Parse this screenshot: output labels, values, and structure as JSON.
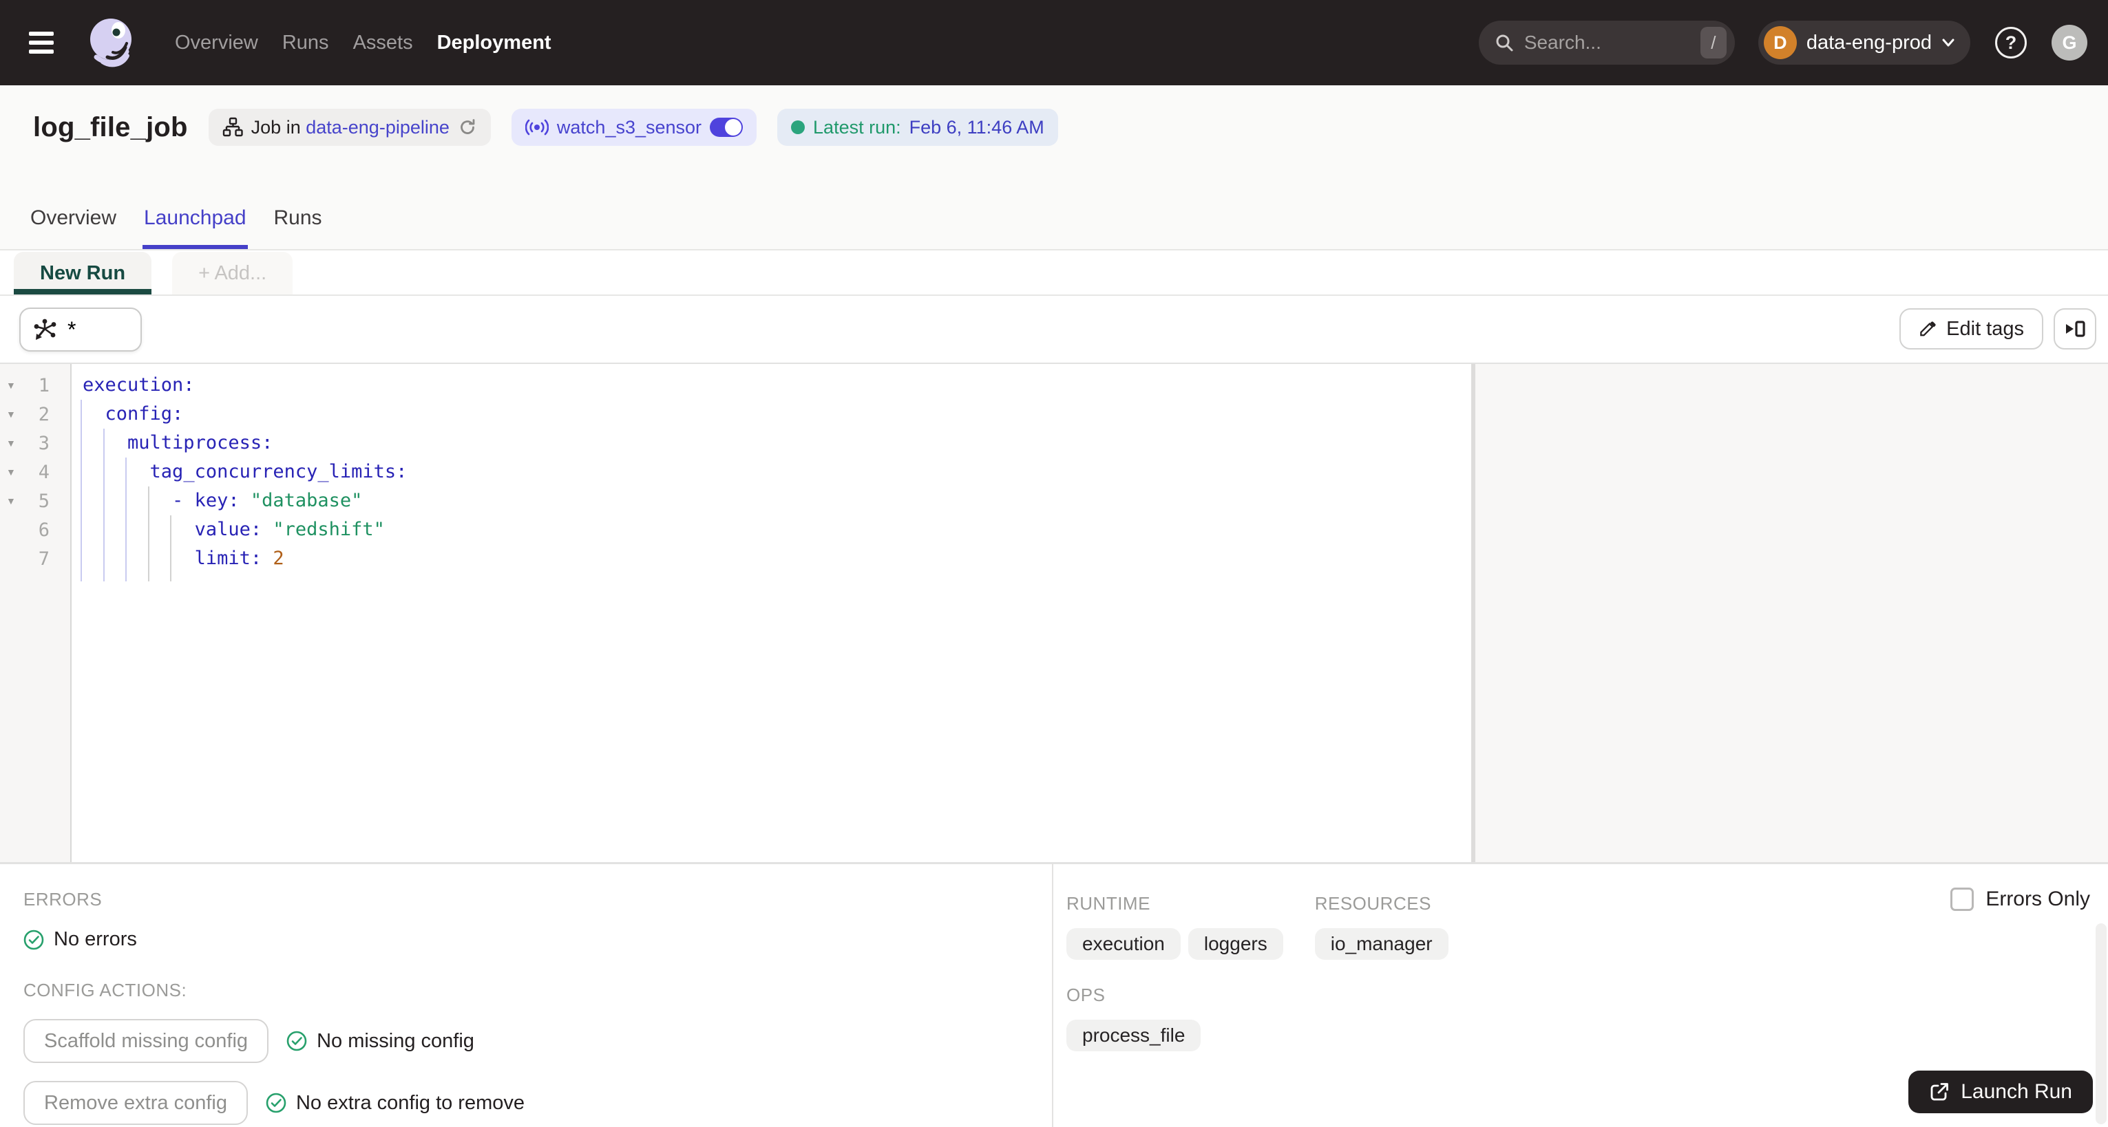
{
  "nav": {
    "items": [
      {
        "label": "Overview",
        "active": false
      },
      {
        "label": "Runs",
        "active": false
      },
      {
        "label": "Assets",
        "active": false
      },
      {
        "label": "Deployment",
        "active": true
      }
    ],
    "search_placeholder": "Search...",
    "search_shortcut": "/",
    "deployment_name": "data-eng-prod",
    "deployment_initial": "D",
    "help_glyph": "?",
    "avatar_initial": "G"
  },
  "header": {
    "title": "log_file_job",
    "job_pill": {
      "prefix": "Job in",
      "link": "data-eng-pipeline"
    },
    "sensor_pill": {
      "name": "watch_s3_sensor",
      "enabled": true
    },
    "latest_run": {
      "label": "Latest run:",
      "value": "Feb 6, 11:46 AM"
    },
    "tabs": [
      {
        "label": "Overview",
        "active": false
      },
      {
        "label": "Launchpad",
        "active": true
      },
      {
        "label": "Runs",
        "active": false
      }
    ]
  },
  "launchpad": {
    "config_tabs": [
      {
        "label": "New Run",
        "active": true
      },
      {
        "label": "+ Add...",
        "active": false
      }
    ],
    "op_selector_value": "*",
    "edit_tags_label": "Edit tags"
  },
  "editor": {
    "lines": [
      {
        "n": 1,
        "fold": true,
        "tokens": [
          {
            "c": "k",
            "t": "execution:"
          }
        ]
      },
      {
        "n": 2,
        "fold": true,
        "tokens": [
          {
            "c": "sp",
            "t": "  "
          },
          {
            "c": "k",
            "t": "config:"
          }
        ]
      },
      {
        "n": 3,
        "fold": true,
        "tokens": [
          {
            "c": "sp",
            "t": "    "
          },
          {
            "c": "k",
            "t": "multiprocess:"
          }
        ]
      },
      {
        "n": 4,
        "fold": true,
        "tokens": [
          {
            "c": "sp",
            "t": "      "
          },
          {
            "c": "k",
            "t": "tag_concurrency_limits:"
          }
        ]
      },
      {
        "n": 5,
        "fold": true,
        "tokens": [
          {
            "c": "sp",
            "t": "        "
          },
          {
            "c": "d",
            "t": "- "
          },
          {
            "c": "k",
            "t": "key:"
          },
          {
            "c": "sp",
            "t": " "
          },
          {
            "c": "s",
            "t": "\"database\""
          }
        ]
      },
      {
        "n": 6,
        "fold": false,
        "tokens": [
          {
            "c": "sp",
            "t": "          "
          },
          {
            "c": "k",
            "t": "value:"
          },
          {
            "c": "sp",
            "t": " "
          },
          {
            "c": "s",
            "t": "\"redshift\""
          }
        ]
      },
      {
        "n": 7,
        "fold": false,
        "tokens": [
          {
            "c": "sp",
            "t": "          "
          },
          {
            "c": "k",
            "t": "limit:"
          },
          {
            "c": "sp",
            "t": " "
          },
          {
            "c": "n",
            "t": "2"
          }
        ]
      }
    ],
    "guides": [
      {
        "col": 0,
        "from": 2
      },
      {
        "col": 1,
        "from": 3
      },
      {
        "col": 2,
        "from": 4
      },
      {
        "col": 3,
        "from": 5
      },
      {
        "col": 4,
        "from": 6
      }
    ]
  },
  "bottom_left": {
    "errors_label": "ERRORS",
    "no_errors": "No errors",
    "config_actions_label": "CONFIG ACTIONS:",
    "actions": [
      {
        "button": "Scaffold missing config",
        "status": "No missing config"
      },
      {
        "button": "Remove extra config",
        "status": "No extra config to remove"
      }
    ]
  },
  "bottom_right": {
    "sections": [
      {
        "label": "RUNTIME",
        "tags": [
          "execution",
          "loggers"
        ]
      },
      {
        "label": "RESOURCES",
        "tags": [
          "io_manager"
        ]
      },
      {
        "label": "OPS",
        "tags": [
          "process_file"
        ]
      }
    ],
    "errors_only_label": "Errors Only",
    "launch_label": "Launch Run"
  },
  "colors": {
    "nav_bg": "#252021",
    "blurple_link": "#4744CB",
    "active_tab": "#4540C8",
    "launchpad_teal": "#1B4A42",
    "success_green": "#27A06C",
    "deployment_orange": "#D2812A",
    "code_key_navy": "#2823B5",
    "code_string_green": "#1F9161",
    "code_number_orange": "#B06019"
  }
}
